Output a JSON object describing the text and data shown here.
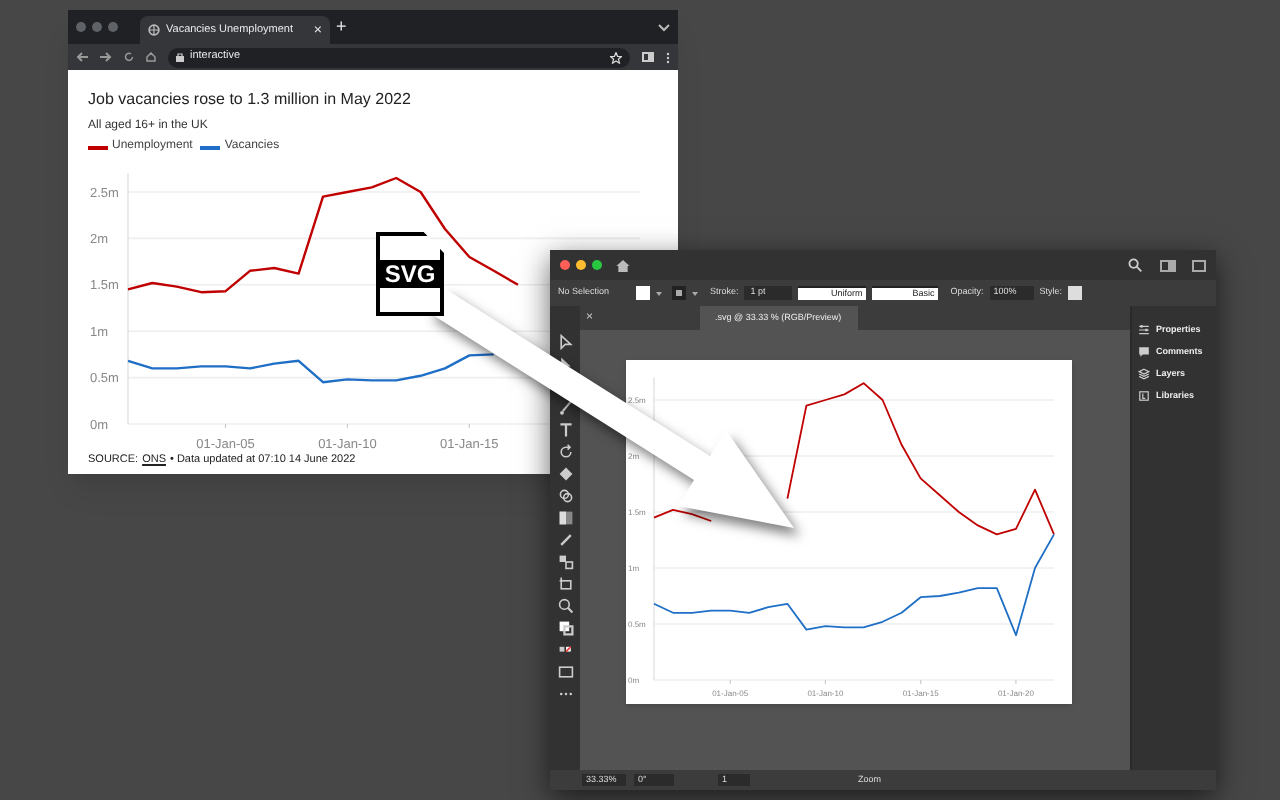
{
  "browser": {
    "tab_title": "Vacancies Unemployment",
    "tab_close": "×",
    "new_tab": "+",
    "address": "interactive"
  },
  "article": {
    "title": "Job vacancies rose to 1.3 million in May 2022",
    "subtitle": "All aged 16+ in the UK",
    "chart_data": {
      "type": "line",
      "categories": [
        null,
        null,
        null,
        null,
        "01-Jan-05",
        null,
        null,
        null,
        null,
        "01-Jan-10",
        null,
        null,
        null,
        null,
        "01-Jan-15",
        null,
        null,
        null,
        null,
        null,
        null,
        null
      ],
      "series": [
        {
          "name": "Unemployment",
          "color": "#c00000",
          "values": [
            1.45,
            1.52,
            1.48,
            1.42,
            1.43,
            1.65,
            1.68,
            1.62,
            2.45,
            2.5,
            2.55,
            2.65,
            2.5,
            2.1,
            1.8,
            1.65,
            1.5,
            null,
            null,
            null,
            null,
            null
          ]
        },
        {
          "name": "Vacancies",
          "color": "#1f6fc6",
          "values": [
            0.68,
            0.6,
            0.6,
            0.62,
            0.62,
            0.6,
            0.65,
            0.68,
            0.45,
            0.48,
            0.47,
            0.47,
            0.52,
            0.6,
            0.74,
            0.75,
            null,
            null,
            null,
            null,
            null,
            null
          ]
        }
      ],
      "ylim": [
        0,
        2.7
      ],
      "grid": true,
      "yticks": [
        {
          "value": 0,
          "label": "0m"
        },
        {
          "value": 0.5,
          "label": "0.5m"
        },
        {
          "value": 1,
          "label": "1m"
        },
        {
          "value": 1.5,
          "label": "1.5m"
        },
        {
          "value": 2,
          "label": "2m"
        },
        {
          "value": 2.5,
          "label": "2.5m"
        }
      ]
    },
    "source_label": "SOURCE:",
    "source_link": "ONS",
    "source_note": "• Data updated at 07:10 14 June 2022"
  },
  "file_icon": {
    "label": "SVG"
  },
  "illustrator": {
    "control_bar": {
      "selection": "No Selection",
      "stroke_label": "Stroke:",
      "stroke_weight": "1 pt",
      "profile": "Uniform",
      "brush": "Basic",
      "opacity_label": "Opacity:",
      "opacity": "100%",
      "style_label": "Style:"
    },
    "doc_tab": {
      "close": "×",
      "title": ".svg @ 33.33 % (RGB/Preview)"
    },
    "panels": [
      {
        "label": "Properties"
      },
      {
        "label": "Comments"
      },
      {
        "label": "Layers"
      },
      {
        "label": "Libraries"
      }
    ],
    "artboard": {
      "chart_data": {
        "type": "line",
        "categories": [
          null,
          null,
          null,
          null,
          "01-Jan-05",
          null,
          null,
          null,
          null,
          "01-Jan-10",
          null,
          null,
          null,
          null,
          "01-Jan-15",
          null,
          null,
          null,
          null,
          "01-Jan-20",
          null,
          null
        ],
        "series": [
          {
            "color": "#c00000",
            "values": [
              1.45,
              1.52,
              1.48,
              1.42,
              null,
              null,
              null,
              1.62,
              2.45,
              2.5,
              2.55,
              2.65,
              2.5,
              2.1,
              1.8,
              1.65,
              1.5,
              1.38,
              1.3,
              1.35,
              1.7,
              1.3
            ]
          },
          {
            "color": "#1f6fc6",
            "values": [
              0.68,
              0.6,
              0.6,
              0.62,
              0.62,
              0.6,
              0.65,
              0.68,
              0.45,
              0.48,
              0.47,
              0.47,
              0.52,
              0.6,
              0.74,
              0.75,
              0.78,
              0.82,
              0.82,
              0.4,
              1.0,
              1.3
            ]
          }
        ],
        "ylim": [
          0,
          2.7
        ],
        "grid": true,
        "yticks": [
          {
            "value": 0,
            "label": "0m"
          },
          {
            "value": 0.5,
            "label": "0.5m"
          },
          {
            "value": 1,
            "label": "1m"
          },
          {
            "value": 1.5,
            "label": "1.5m"
          },
          {
            "value": 2,
            "label": "2m"
          },
          {
            "value": 2.5,
            "label": "2.5m"
          }
        ]
      }
    },
    "status_bar": {
      "zoom": "33.33%",
      "rotation": "0°",
      "artboard": "1",
      "tool": "Zoom"
    }
  }
}
